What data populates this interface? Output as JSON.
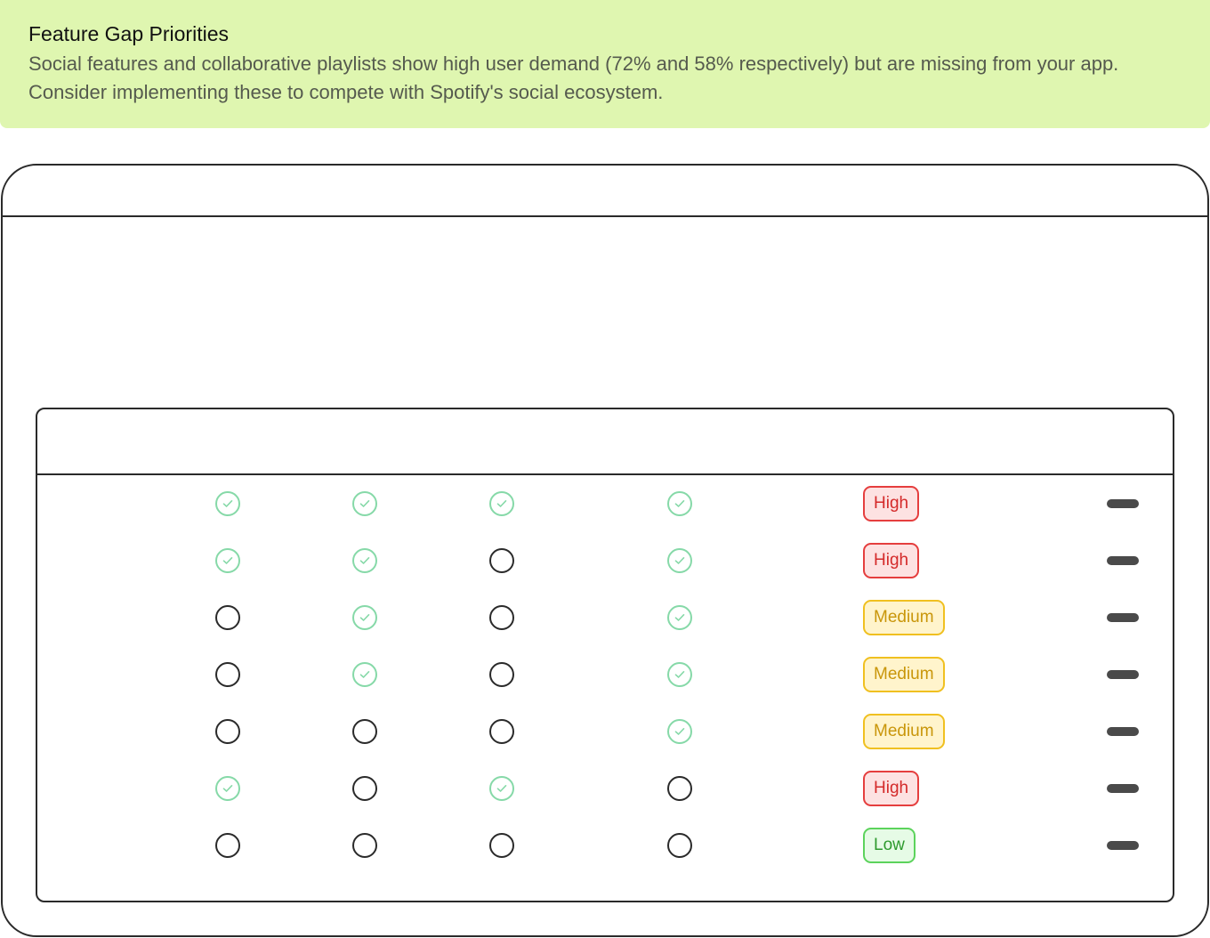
{
  "banner": {
    "title": "Feature Gap Priorities",
    "body_line1": "Social features and collaborative playlists show high user demand (72% and 58% respectively) but are missing from your app.",
    "body_line2": "Consider implementing these to compete with Spotify's social ecosystem."
  },
  "table": {
    "rows": [
      {
        "status": [
          true,
          true,
          true,
          true
        ],
        "priority": "High",
        "level": "high"
      },
      {
        "status": [
          true,
          true,
          false,
          true
        ],
        "priority": "High",
        "level": "high"
      },
      {
        "status": [
          false,
          true,
          false,
          true
        ],
        "priority": "Medium",
        "level": "medium"
      },
      {
        "status": [
          false,
          true,
          false,
          true
        ],
        "priority": "Medium",
        "level": "medium"
      },
      {
        "status": [
          false,
          false,
          false,
          true
        ],
        "priority": "Medium",
        "level": "medium"
      },
      {
        "status": [
          true,
          false,
          true,
          false
        ],
        "priority": "High",
        "level": "high"
      },
      {
        "status": [
          false,
          false,
          false,
          false
        ],
        "priority": "Low",
        "level": "low"
      }
    ]
  },
  "colors": {
    "banner_bg": "#dff6b0",
    "check": "#86d9a8",
    "high": "#e53e3e",
    "medium": "#f0c020",
    "low": "#5cd35c"
  },
  "icons": {
    "yes": "check-circle-icon",
    "no": "empty-circle-icon"
  }
}
